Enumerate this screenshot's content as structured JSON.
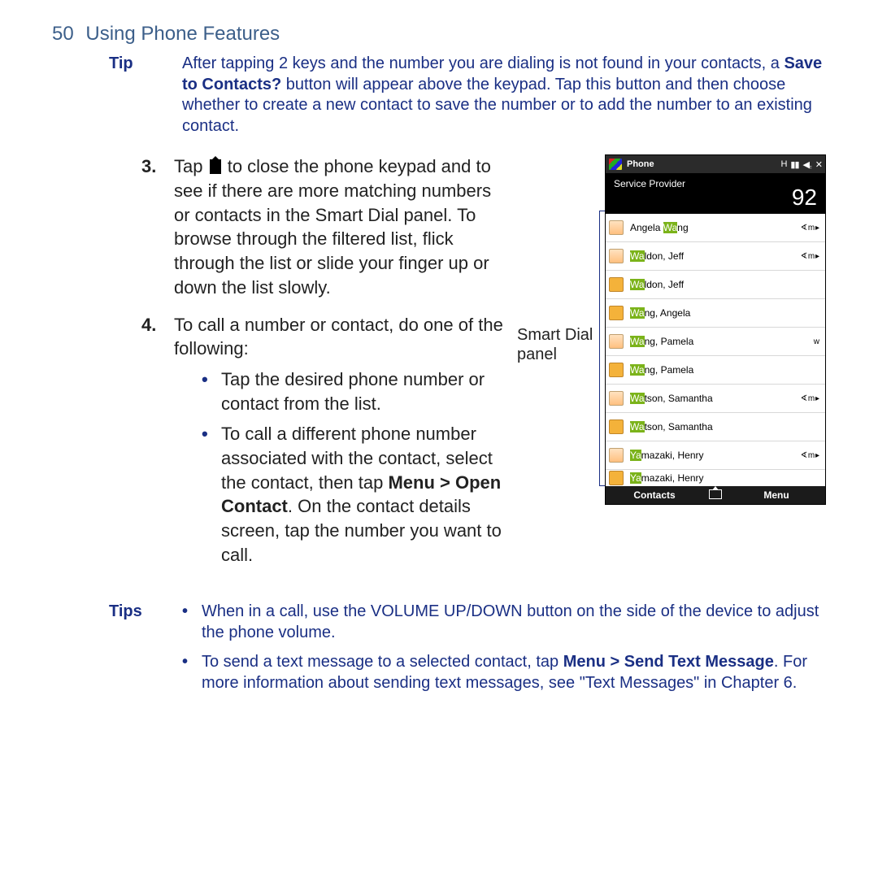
{
  "page": {
    "number": "50",
    "title": "Using Phone Features"
  },
  "tip": {
    "label": "Tip",
    "text_a": "After tapping 2 keys and the number you are dialing is not found in your contacts, a ",
    "bold": "Save to Contacts?",
    "text_b": " button will appear above the keypad. Tap this button and then choose whether to create a new contact to save the number or to add the number to an existing contact."
  },
  "steps": {
    "s3": {
      "num": "3.",
      "pre": "Tap ",
      "post": " to close the phone keypad and to see if there are more matching numbers or contacts in the Smart Dial panel. To browse through the filtered list, flick through the list or slide your finger up or down the list slowly."
    },
    "s4": {
      "num": "4.",
      "lead": "To call a number or contact, do one of the following:",
      "b1": "Tap the desired phone number or contact from the list.",
      "b2a": "To call a different phone number associated with the contact, select the contact, then tap ",
      "b2b": "Menu > Open Contact",
      "b2c": ". On the contact details screen, tap the number you want to call."
    }
  },
  "side_label": "Smart Dial panel",
  "phone": {
    "top_title": "Phone",
    "provider": "Service Provider",
    "dialed": "92",
    "soft_left": "Contacts",
    "soft_right": "Menu",
    "contacts": [
      {
        "icon": "person",
        "pre": "Angela ",
        "hl": "Wa",
        "post": "ng",
        "tag": "∢ m ▸"
      },
      {
        "icon": "person",
        "pre": "",
        "hl": "Wa",
        "post": "ldon, Jeff",
        "tag": "∢ m ▸"
      },
      {
        "icon": "sim",
        "pre": "",
        "hl": "Wa",
        "post": "ldon, Jeff",
        "tag": ""
      },
      {
        "icon": "sim",
        "pre": "",
        "hl": "Wa",
        "post": "ng, Angela",
        "tag": ""
      },
      {
        "icon": "person",
        "pre": "",
        "hl": "Wa",
        "post": "ng, Pamela",
        "tag": "w"
      },
      {
        "icon": "sim",
        "pre": "",
        "hl": "Wa",
        "post": "ng, Pamela",
        "tag": ""
      },
      {
        "icon": "person",
        "pre": "",
        "hl": "Wa",
        "post": "tson, Samantha",
        "tag": "∢ m ▸"
      },
      {
        "icon": "sim",
        "pre": "",
        "hl": "Wa",
        "post": "tson, Samantha",
        "tag": ""
      },
      {
        "icon": "person",
        "pre": "",
        "hl": "Ya",
        "post": "mazaki, Henry",
        "tag": "∢ m ▸"
      },
      {
        "icon": "sim",
        "pre": "",
        "hl": "Ya",
        "post": "mazaki, Henry",
        "tag": "",
        "last": true
      }
    ]
  },
  "tips": {
    "label": "Tips",
    "b1": "When in a call, use the VOLUME UP/DOWN button on the side of the device to adjust the phone volume.",
    "b2a": "To send a text message to a selected contact, tap ",
    "b2b": "Menu > Send Text Message",
    "b2c": ". For more information about sending text messages, see \"Text Messages\" in Chapter 6."
  }
}
